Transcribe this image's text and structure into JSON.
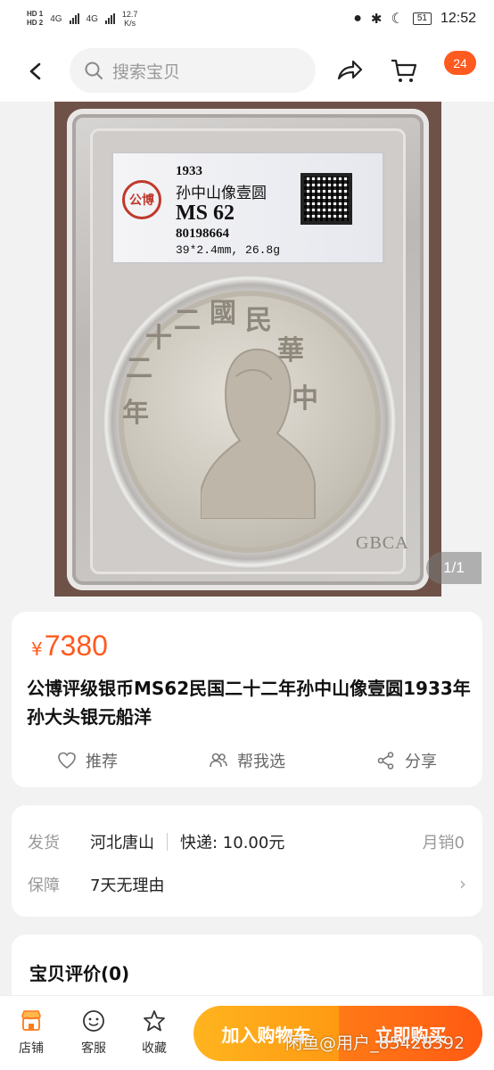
{
  "status_bar": {
    "hd1": "HD 1",
    "hd2": "HD 2",
    "net1": "4G",
    "net2": "4G",
    "speed_value": "12.7",
    "speed_unit": "K/s",
    "battery": "51",
    "time": "12:52"
  },
  "nav": {
    "search_placeholder": "搜索宝贝",
    "cart_badge": "24"
  },
  "photo": {
    "label_year": "1933",
    "label_name": "孙中山像壹圆",
    "label_grade": "MS 62",
    "label_serial": "80198664",
    "label_size": "39*2.4mm, 26.8g",
    "seal_text": "公博",
    "coin_chars": [
      "中",
      "華",
      "民",
      "國",
      "二",
      "十",
      "二",
      "年"
    ],
    "grader_mark": "GBCA",
    "counter": "1/1"
  },
  "product": {
    "currency": "¥",
    "price": "7380",
    "title": "公博评级银币MS62民国二十二年孙中山像壹圆1933年孙大头银元船洋",
    "actions": {
      "recommend": "推荐",
      "help_choose": "帮我选",
      "share": "分享"
    }
  },
  "shipping": {
    "ship_key": "发货",
    "ship_from": "河北唐山",
    "express": "快递: 10.00元",
    "monthly_sales": "月销0",
    "guarantee_key": "保障",
    "guarantee_value": "7天无理由"
  },
  "reviews": {
    "title": "宝贝评价(0)"
  },
  "bottom_bar": {
    "store": "店铺",
    "service": "客服",
    "favorite": "收藏",
    "add_to_cart": "加入购物车",
    "buy_now": "立即购买"
  },
  "watermark": "闲鱼@用户_85428392",
  "colors": {
    "accent": "#ff5a1f",
    "cart_button": "#ffa81a",
    "buy_button": "#ff6414"
  }
}
